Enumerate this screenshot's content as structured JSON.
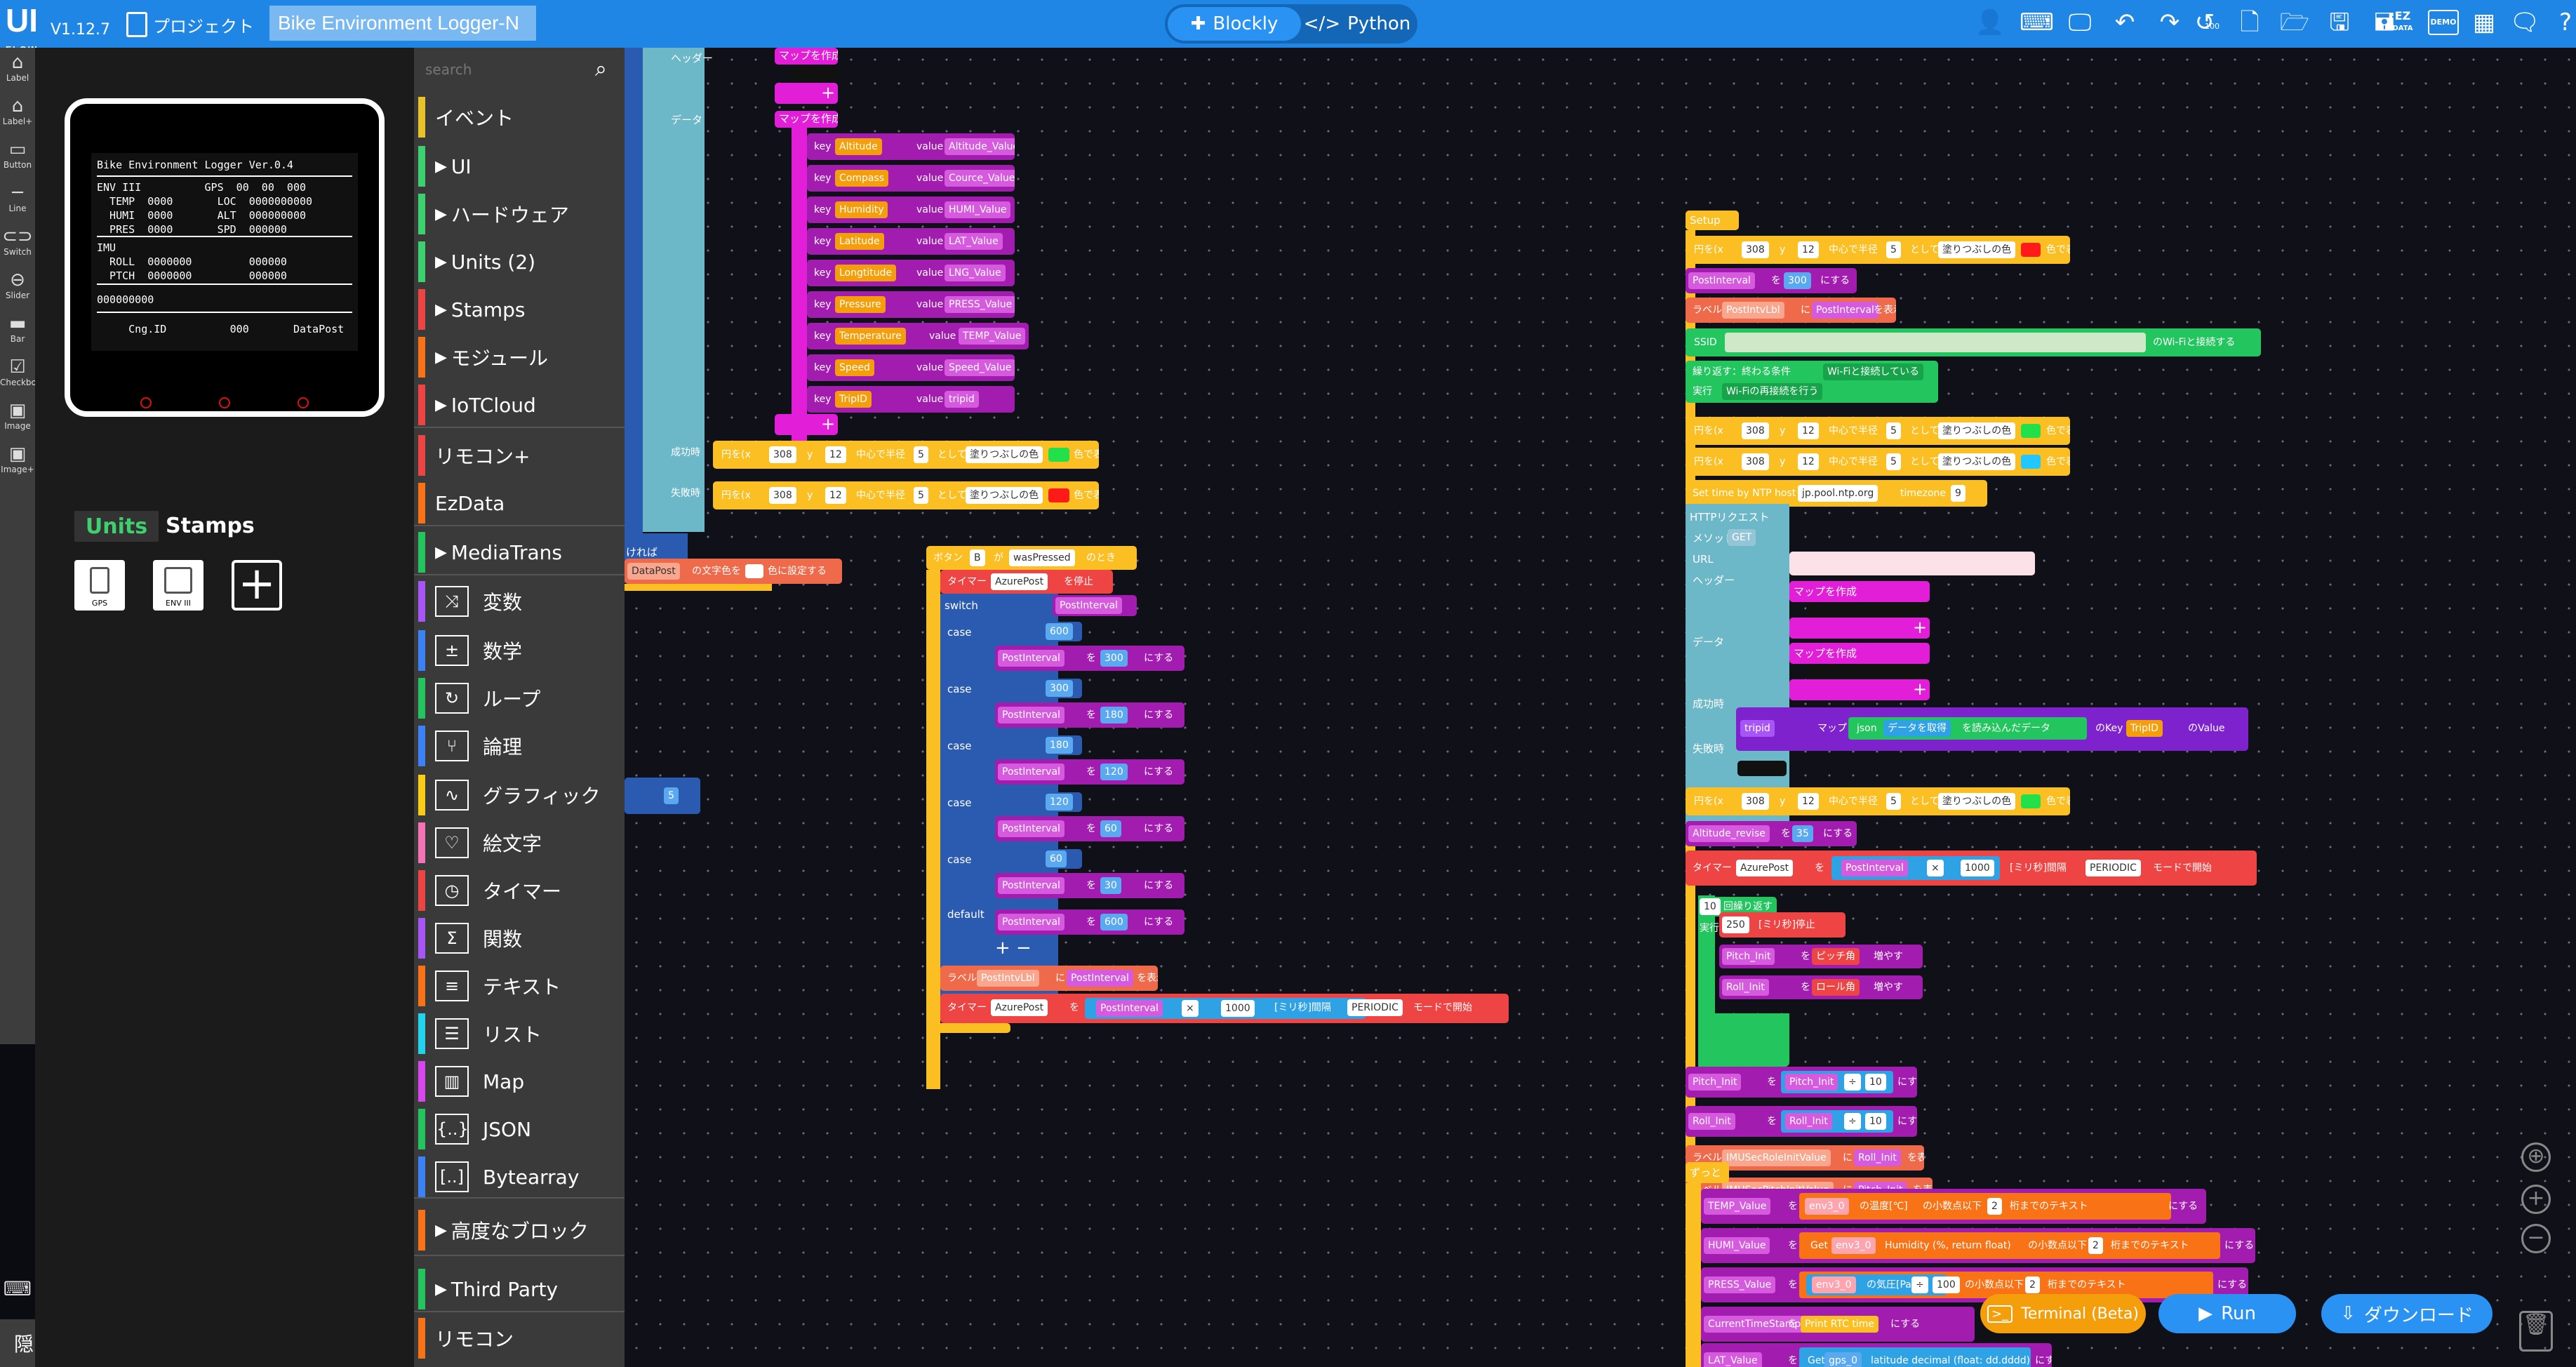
{
  "header": {
    "logo": "UI",
    "logo_sub": "FLOW",
    "version": "V1.12.7",
    "project_label": "プロジェクト",
    "project_title": "Bike Environment Logger-N",
    "mode_blockly": "Blockly",
    "mode_python": "Python",
    "ez_top": "EZ",
    "ez_bottom": "DATA",
    "demo": "DEMO",
    "history_badge": "100",
    "icons": [
      "user-icon",
      "keyboard-icon",
      "device-icon",
      "undo-icon",
      "redo-icon",
      "history-icon",
      "new-file-icon",
      "open-folder-icon",
      "save-icon",
      "save-as-icon",
      "ezdata-icon",
      "demo-icon",
      "examples-icon",
      "chat-icon",
      "help-icon"
    ]
  },
  "toolstrip": {
    "tools": [
      "Label",
      "Label+",
      "Button",
      "Line",
      "Switch",
      "Slider",
      "Bar",
      "Checkbox",
      "Image",
      "Image+"
    ],
    "hide_label": "隠す"
  },
  "device": {
    "title": "Bike Environment Logger Ver.0.4",
    "rows": [
      "ENV III          GPS  00  00  000",
      "  TEMP  0000       LOC  0000000000",
      "  HUMI  0000       ALT  000000000",
      "  PRES  0000       SPD  000000",
      "IMU",
      "  ROLL  0000000         000000",
      "  PTCH  0000000         000000",
      "000000000",
      "     Cng.ID          000       DataPost"
    ],
    "units_tab": "Units",
    "stamps_tab": "Stamps",
    "unit_chips": [
      "GPS",
      "ENV III"
    ]
  },
  "categories": {
    "search_placeholder": "search",
    "items": [
      {
        "label": "イベント",
        "color": "#e8c228",
        "arrow": false
      },
      {
        "label": "UI",
        "color": "#3bd16f",
        "arrow": true
      },
      {
        "label": "ハードウェア",
        "color": "#3bd16f",
        "arrow": true
      },
      {
        "label": "Units (2)",
        "color": "#3bd16f",
        "arrow": true
      },
      {
        "label": "Stamps",
        "color": "#ef4444",
        "arrow": true
      },
      {
        "label": "モジュール",
        "color": "#f97316",
        "arrow": true
      },
      {
        "label": "IoTCloud",
        "color": "#ef4444",
        "arrow": true
      },
      {
        "label": "リモコン+",
        "color": "#ef4444",
        "arrow": false
      },
      {
        "label": "EzData",
        "color": "#f97316",
        "arrow": false
      },
      {
        "label": "MediaTrans",
        "color": "#22c55e",
        "arrow": true
      },
      {
        "label": "変数",
        "color": "#a855f7",
        "icon": "variable-icon",
        "glyph": "⤨"
      },
      {
        "label": "数学",
        "color": "#3b82f6",
        "icon": "math-icon",
        "glyph": "±"
      },
      {
        "label": "ループ",
        "color": "#22c55e",
        "icon": "loop-icon",
        "glyph": "↻"
      },
      {
        "label": "論理",
        "color": "#3b82f6",
        "icon": "logic-icon",
        "glyph": "⑂"
      },
      {
        "label": "グラフィック",
        "color": "#facc15",
        "icon": "graphic-icon",
        "glyph": "∿"
      },
      {
        "label": "絵文字",
        "color": "#f472b6",
        "icon": "emoji-icon",
        "glyph": "♡"
      },
      {
        "label": "タイマー",
        "color": "#ef4444",
        "icon": "timer-icon",
        "glyph": "◷"
      },
      {
        "label": "関数",
        "color": "#a855f7",
        "icon": "function-icon",
        "glyph": "Σ"
      },
      {
        "label": "テキスト",
        "color": "#f97316",
        "icon": "text-icon",
        "glyph": "≡"
      },
      {
        "label": "リスト",
        "color": "#22d3ee",
        "icon": "list-icon",
        "glyph": "☰"
      },
      {
        "label": "Map",
        "color": "#d946ef",
        "icon": "map-icon",
        "glyph": "▥"
      },
      {
        "label": "JSON",
        "color": "#22c55e",
        "icon": "json-icon",
        "glyph": "{..}"
      },
      {
        "label": "Bytearray",
        "color": "#3b82f6",
        "icon": "bytearray-icon",
        "glyph": "[..]"
      },
      {
        "label": "高度なブロック",
        "color": "#f97316",
        "arrow": true
      },
      {
        "label": "Third Party",
        "color": "#22c55e",
        "arrow": true
      },
      {
        "label": "リモコン",
        "color": "#f97316",
        "arrow": false
      }
    ]
  },
  "workspace": {
    "left_group": {
      "header_label": "ヘッダー",
      "data_label": "データ",
      "make_map": "マップを作成",
      "keys": [
        {
          "key": "Altitude",
          "value": "Altitude_Value"
        },
        {
          "key": "Compass",
          "value": "Cource_Value"
        },
        {
          "key": "Humidity",
          "value": "HUMI_Value"
        },
        {
          "key": "Latitude",
          "value": "LAT_Value"
        },
        {
          "key": "Longtitude",
          "value": "LNG_Value"
        },
        {
          "key": "Pressure",
          "value": "PRESS_Value"
        },
        {
          "key": "Temperature",
          "value": "TEMP_Value"
        },
        {
          "key": "Speed",
          "value": "Speed_Value"
        },
        {
          "key": "TripID",
          "value": "tripid"
        }
      ],
      "success_label": "成功時",
      "fail_label": "失敗時",
      "circle_text": "円を(x",
      "circle_x": "308",
      "circle_y": "12",
      "circle_mid": "中心で半径",
      "circle_r": "5",
      "circle_as": "として",
      "circle_fill": "塗りつぶしの色",
      "circle_show": "色で表示",
      "else_label": "ければ",
      "datapost_label": "DataPost",
      "text_color": "の文字色を",
      "set_color": "色に設定する",
      "small_value": "5"
    },
    "button_group": {
      "button_label": "ボタン",
      "button_name": "B",
      "was_pressed": "wasPressed",
      "when": "のとき",
      "timer_label": "タイマー",
      "timer_name": "AzurePost",
      "stop": "を停止",
      "switch_label": "switch",
      "switch_var": "PostInterval",
      "case_label": "case",
      "default_label": "default",
      "cases": [
        {
          "case": "600",
          "set": "300"
        },
        {
          "case": "300",
          "set": "180"
        },
        {
          "case": "180",
          "set": "120"
        },
        {
          "case": "120",
          "set": "60"
        },
        {
          "case": "60",
          "set": "30"
        }
      ],
      "default_set": "600",
      "to": "を",
      "set_suffix": "にする",
      "label_word": "ラベル",
      "label_name": "PostIntvLbl",
      "label_ni": "に",
      "label_show": "を表示",
      "timer_ms": "1000",
      "timer_interval": "[ミリ秒]間隔",
      "periodic": "PERIODIC",
      "start_mode": "モードで開始",
      "times": "×"
    },
    "setup_group": {
      "setup_label": "Setup",
      "post_interval": "PostInterval",
      "post_val": "300",
      "ssid_label": "SSID",
      "wifi_connect": "のWi-Fiと接続する",
      "repeat_until": "繰り返す：終わる条件",
      "wifi_connected": "Wi-Fiと接続している",
      "exec_label": "実行",
      "wifi_retry": "Wi-Fiの再接続を行う",
      "ntp_text": "Set time by NTP host",
      "ntp_host": "jp.pool.ntp.org",
      "timezone": "timezone",
      "tz_val": "9",
      "http_label": "HTTPリクエスト",
      "method_label": "メソッド",
      "method_val": "GET",
      "url_label": "URL",
      "header_label": "ヘッダー",
      "data_label": "データ",
      "make_map": "マップを作成",
      "success_label": "成功時",
      "fail_label": "失敗時",
      "tripid": "tripid",
      "map_word": "マップ",
      "json_word": "json",
      "get_data": "データを取得",
      "loaded_data": "を読み込んだデータ",
      "key_of": "のKey",
      "trip_key": "TripID",
      "value_of": "のValue",
      "alt_revise": "Altitude_revise",
      "alt_val": "35",
      "repeat_times": "回繰り返す",
      "repeat_n": "10",
      "wait_ms": "250",
      "wait_stop": "[ミリ秒]停止",
      "pitch_init": "Pitch_Init",
      "roll_init": "Roll_Init",
      "pitch_angle": "ピッチ角",
      "roll_angle": "ロール角",
      "increase": "増やす",
      "divide": "÷",
      "ten": "10",
      "imu_roll_lbl": "IMUSecRoleInitValue",
      "imu_pitch_lbl": "IMUSecPitchInitValue",
      "forever": "ずっと",
      "temp_value": "TEMP_Value",
      "humi_value": "HUMI_Value",
      "press_value": "PRESS_Value",
      "ts_value": "CurrentTimeStamp",
      "lat_value": "LAT_Value",
      "env_name": "env3_0",
      "temp_txt": "の温度[℃]",
      "decimal_txt": "の小数点以下",
      "digits": "2",
      "digits_txt": "桁までのテキスト",
      "get_word": "Get",
      "humidity_txt": "Humidity (%, return float)",
      "pressure_txt": "の気圧[Pa]",
      "hundred": "100",
      "rtc_txt": "Print RTC time",
      "gps_name": "gps_0",
      "lat_txt": "latitude decimal (float: dd.dddd)",
      "colors": {
        "red": "#ff1a1a",
        "green": "#22e04a",
        "cyan": "#22c7ff"
      }
    }
  },
  "bottom": {
    "terminal": "Terminal (Beta)",
    "run": "Run",
    "download": "ダウンロード"
  }
}
